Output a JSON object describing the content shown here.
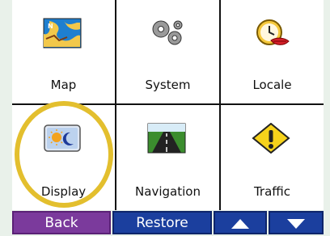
{
  "menu": {
    "items": [
      {
        "label": "Map",
        "icon": "map-icon"
      },
      {
        "label": "System",
        "icon": "gears-icon"
      },
      {
        "label": "Locale",
        "icon": "clock-lips-icon"
      },
      {
        "label": "Display",
        "icon": "display-sun-moon-icon"
      },
      {
        "label": "Navigation",
        "icon": "road-icon"
      },
      {
        "label": "Traffic",
        "icon": "warning-sign-icon"
      }
    ]
  },
  "bottom_bar": {
    "back_label": "Back",
    "restore_label": "Restore",
    "up_icon": "triangle-up-icon",
    "down_icon": "triangle-down-icon"
  },
  "colors": {
    "back": "#7b3a9c",
    "blue": "#1b3f9e",
    "highlight": "#e3bf2e"
  }
}
